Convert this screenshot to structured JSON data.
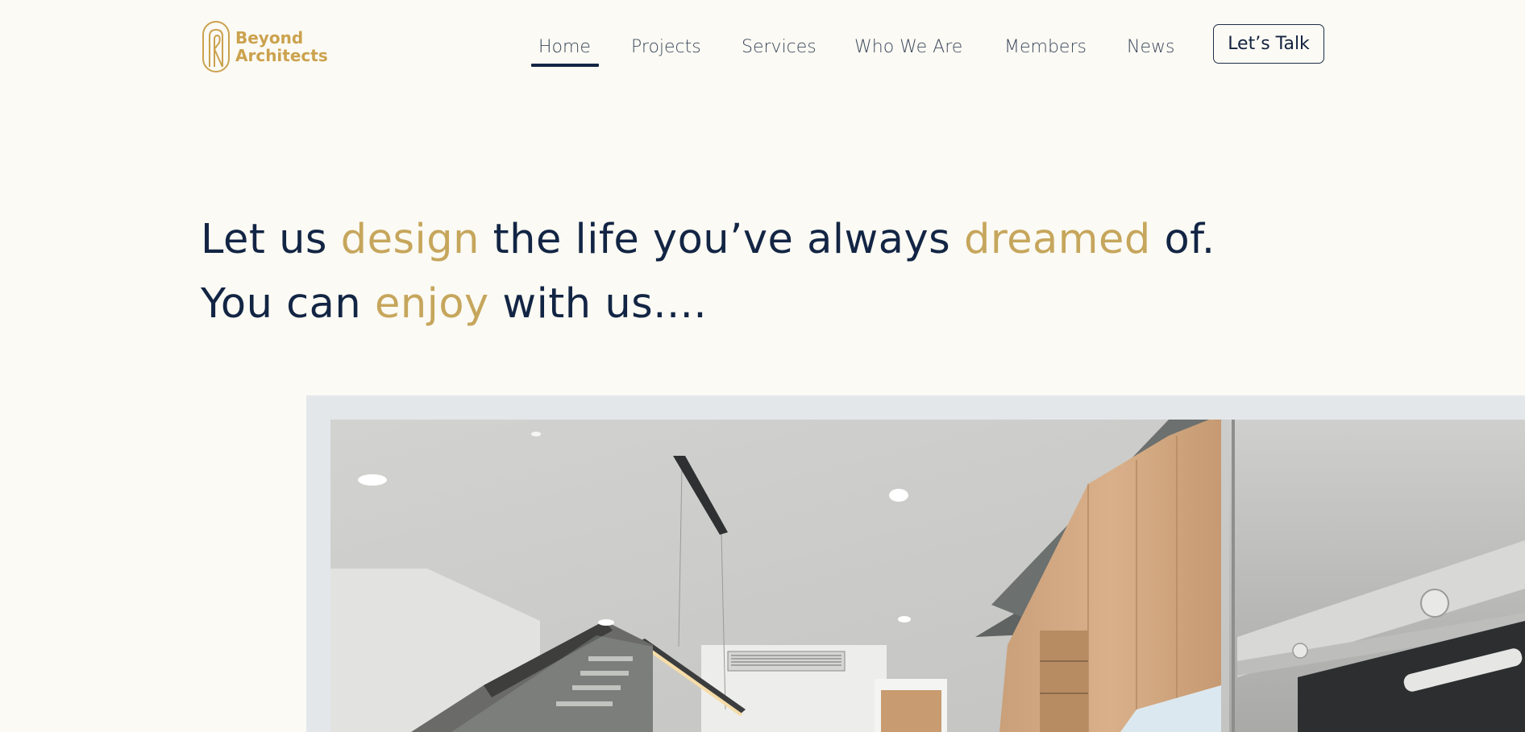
{
  "brand": {
    "name_line1": "Beyond",
    "name_line2": "Architects",
    "logo_monogram": "AR",
    "color_gold": "#cba24e",
    "color_navy": "#132544"
  },
  "nav": {
    "items": [
      {
        "label": "Home",
        "active": true
      },
      {
        "label": "Projects"
      },
      {
        "label": "Services"
      },
      {
        "label": "Who We Are"
      },
      {
        "label": "Members"
      },
      {
        "label": "News"
      }
    ],
    "cta_label": "Let’s Talk"
  },
  "hero": {
    "line1": {
      "p1": "Let us ",
      "h1": "design",
      "p2": " the life you’ve always ",
      "h2": "dreamed",
      "p3": " of."
    },
    "line2": {
      "p1": "You can ",
      "h1": "enjoy",
      "p2": " with us...."
    }
  },
  "hero_image": {
    "subject": "modern interior with kitchen cabinetry, pendant light and staircase"
  }
}
